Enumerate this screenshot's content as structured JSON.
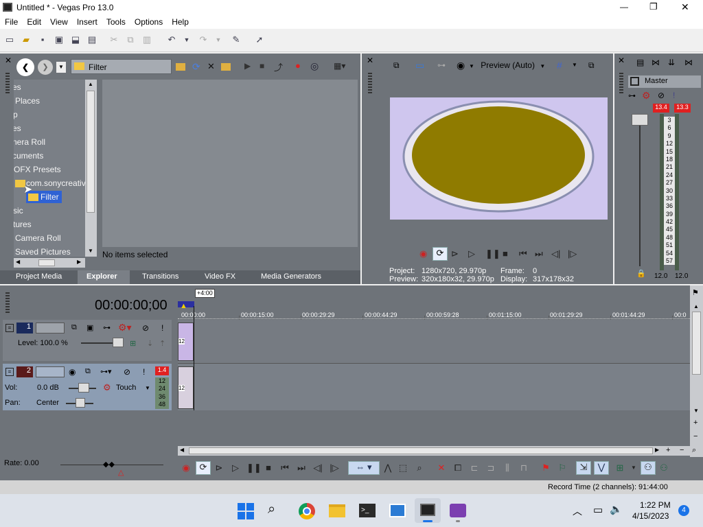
{
  "window": {
    "title": "Untitled * - Vegas Pro 13.0",
    "min": "—",
    "max": "❐",
    "close": "✕"
  },
  "menu": [
    "File",
    "Edit",
    "View",
    "Insert",
    "Tools",
    "Options",
    "Help"
  ],
  "explorer": {
    "path": "Filter",
    "tree": [
      "es",
      "Places",
      "p",
      "es",
      "nera Roll",
      "cuments",
      "OFX Presets",
      "com.sonycreativ",
      "Filter",
      "sic",
      "tures",
      "Camera Roll",
      "Saved Pictures"
    ],
    "selected_index": 8,
    "status": "No items selected",
    "tabs": [
      "Project Media",
      "Explorer",
      "Transitions",
      "Video FX",
      "Media Generators"
    ],
    "active_tab": 1
  },
  "preview": {
    "mode": "Preview (Auto)",
    "project_label": "Project:",
    "project_value": "1280x720, 29.970p",
    "preview_label": "Preview:",
    "preview_value": "320x180x32, 29.970p",
    "frame_label": "Frame:",
    "frame_value": "0",
    "display_label": "Display:",
    "display_value": "317x178x32",
    "frame_colors": {
      "bg": "#cfc6ee",
      "bowl": "#8f7b00",
      "rim": "#e9e6ef"
    }
  },
  "master": {
    "title": "Master",
    "peak_l": "13.4",
    "peak_r": "13.3",
    "scale": [
      "3",
      "6",
      "9",
      "12",
      "15",
      "18",
      "21",
      "24",
      "27",
      "30",
      "33",
      "36",
      "39",
      "42",
      "45",
      "48",
      "51",
      "54",
      "57"
    ],
    "level_l": "12.0",
    "level_r": "12.0"
  },
  "timeline": {
    "timecode": "00:00:00;00",
    "offset": "+4:00",
    "ruler": [
      "00:00:00",
      "00:00:15:00",
      "00:00:29:29",
      "00:00:44:29",
      "00:00:59:28",
      "00:01:15:00",
      "00:01:29:29",
      "00:01:44:29",
      "00:0"
    ],
    "track1": {
      "num": "1",
      "level": "Level: 100.0 %"
    },
    "track2": {
      "num": "2",
      "peak": "1.4",
      "vol_label": "Vol:",
      "vol_value": "0.0 dB",
      "pan_label": "Pan:",
      "pan_value": "Center",
      "mode": "Touch",
      "meter": [
        "12",
        "24",
        "36",
        "48"
      ]
    },
    "rate": "Rate: 0.00"
  },
  "status": {
    "record": "Record Time (2 channels): 91:44:00"
  },
  "taskbar": {
    "time": "1:22 PM",
    "date": "4/15/2023",
    "badge": "4"
  }
}
